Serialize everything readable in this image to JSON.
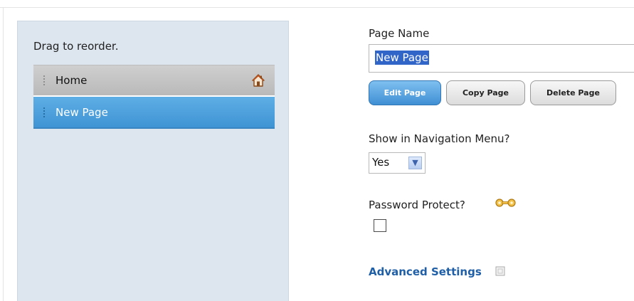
{
  "sidebar": {
    "hint": "Drag to reorder.",
    "pages": [
      {
        "label": "Home",
        "state": "default",
        "icon": "home-icon"
      },
      {
        "label": "New Page",
        "state": "selected"
      }
    ]
  },
  "editor": {
    "page_name_label": "Page Name",
    "page_name_value": "New Page",
    "buttons": {
      "edit": "Edit Page",
      "copy": "Copy Page",
      "delete": "Delete Page"
    },
    "nav_menu_label": "Show in Navigation Menu?",
    "nav_menu_value": "Yes",
    "password_label": "Password Protect?",
    "password_icon": "key-icon",
    "password_checked": false,
    "advanced_label": "Advanced Settings",
    "advanced_icon": "expand-icon"
  },
  "colors": {
    "panel_bg": "#dde6ef",
    "selected_item": "#4a9fdd",
    "primary_button": "#4a96d8",
    "link": "#1f5fa8"
  }
}
